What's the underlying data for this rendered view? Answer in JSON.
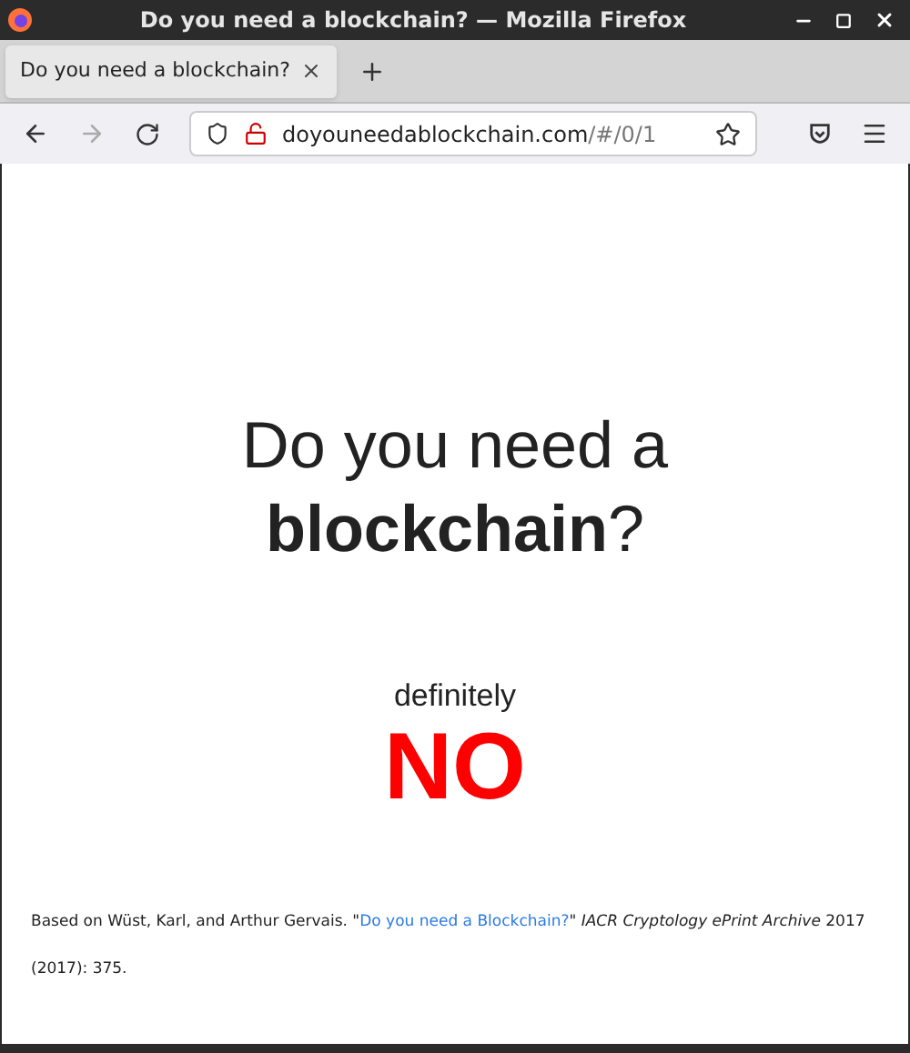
{
  "window": {
    "title": "Do you need a blockchain? — Mozilla Firefox"
  },
  "tabs": [
    {
      "label": "Do you need a blockchain?",
      "selected": true
    }
  ],
  "address_bar": {
    "host": "doyouneedablockchain.com",
    "path": "/#/0/1"
  },
  "nav": {
    "back_disabled": false,
    "forward_disabled": true
  },
  "page": {
    "heading": "Do you need a **blockchain**?",
    "qualifier": "definitely",
    "answer": "NO",
    "citation": {
      "prefix": "Based on Wüst, Karl, and Arthur Gervais. \"",
      "link": "Do you need a Blockchain?",
      "suffix": "\" *IACR Cryptology ePrint Archive* 2017 (2017): 375."
    }
  }
}
